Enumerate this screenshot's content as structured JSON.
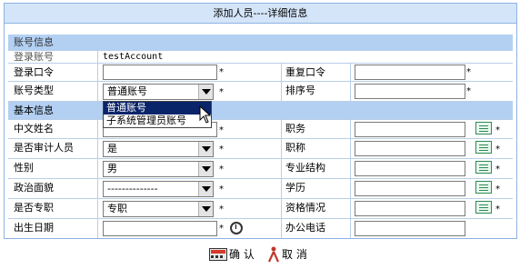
{
  "title": "添加人员----详细信息",
  "section_account": "账号信息",
  "section_basic": "基本信息",
  "account": {
    "login_label": "登录账号",
    "login_value": "testAccount",
    "password_label": "登录口令",
    "password_value": "",
    "repeat_label": "重复口令",
    "repeat_value": "",
    "type_label": "账号类型",
    "type_value": "普通账号",
    "sort_label": "排序号",
    "sort_value": "",
    "type_options": [
      "普通账号",
      "子系统管理员账号"
    ]
  },
  "basic": {
    "name_label": "中文姓名",
    "name_value": "",
    "duty_label": "职务",
    "duty_value": "",
    "audit_label": "是否审计人员",
    "audit_value": "是",
    "title_label": "职称",
    "title_value": "",
    "gender_label": "性别",
    "gender_value": "男",
    "major_label": "专业结构",
    "major_value": "",
    "political_label": "政治面貌",
    "political_value": "--------------",
    "edu_label": "学历",
    "edu_value": "",
    "fulltime_label": "是否专职",
    "fulltime_value": "专职",
    "qual_label": "资格情况",
    "qual_value": "",
    "birth_label": "出生日期",
    "birth_value": "",
    "phone_label": "办公电话",
    "phone_value": ""
  },
  "required_mark": "*",
  "buttons": {
    "confirm": "确 认",
    "cancel": "取 消"
  },
  "icons": {
    "picker": "list-picker-icon",
    "calendar": "alarm-clock-icon"
  }
}
